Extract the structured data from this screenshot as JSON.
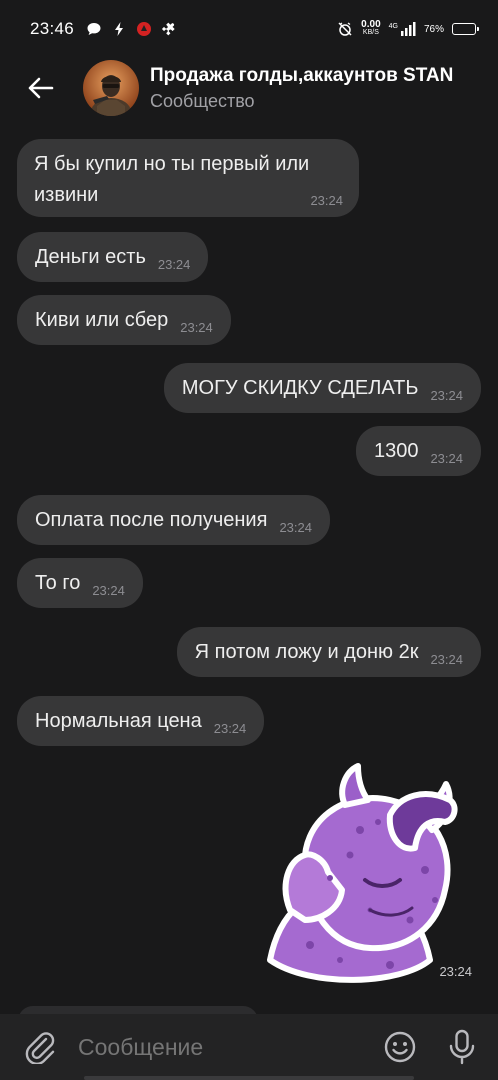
{
  "status_bar": {
    "time": "23:46",
    "net_speed_value": "0.00",
    "net_speed_unit": "KB/S",
    "signal_label": "4G",
    "battery_percent": "76%",
    "battery_level": 0.76
  },
  "header": {
    "title": "Продажа голды,аккаунтов STAN",
    "subtitle": "Сообщество"
  },
  "messages": [
    {
      "side": "in",
      "text": "Я бы купил но ты первый или извини",
      "time": "23:24"
    },
    {
      "side": "in",
      "text": "Деньги есть",
      "time": "23:24"
    },
    {
      "side": "in",
      "text": "Киви или сбер",
      "time": "23:24"
    },
    {
      "side": "out",
      "text": "МОГУ СКИДКУ СДЕЛАТЬ",
      "time": "23:24"
    },
    {
      "side": "out",
      "text": "1300",
      "time": "23:24"
    },
    {
      "side": "in",
      "text": "Оплата после получения",
      "time": "23:24"
    },
    {
      "side": "in",
      "text": "То го",
      "time": "23:24"
    },
    {
      "side": "out",
      "text": "Я потом ложу и доню 2к",
      "time": "23:24"
    },
    {
      "side": "in",
      "text": "Нормальная цена",
      "time": "23:24"
    },
    {
      "side": "out",
      "type": "sticker",
      "sticker": "purple-monster-facepalm",
      "time": "23:24"
    }
  ],
  "input": {
    "placeholder": "Сообщение"
  },
  "icons": {
    "back": "arrow-left-icon",
    "attach": "paperclip-icon",
    "emoji": "smiley-icon",
    "mic": "microphone-icon"
  },
  "colors": {
    "background": "#19191a",
    "bubble": "#373738",
    "input_bar": "#232324",
    "sticker_main": "#9b5fc9"
  }
}
